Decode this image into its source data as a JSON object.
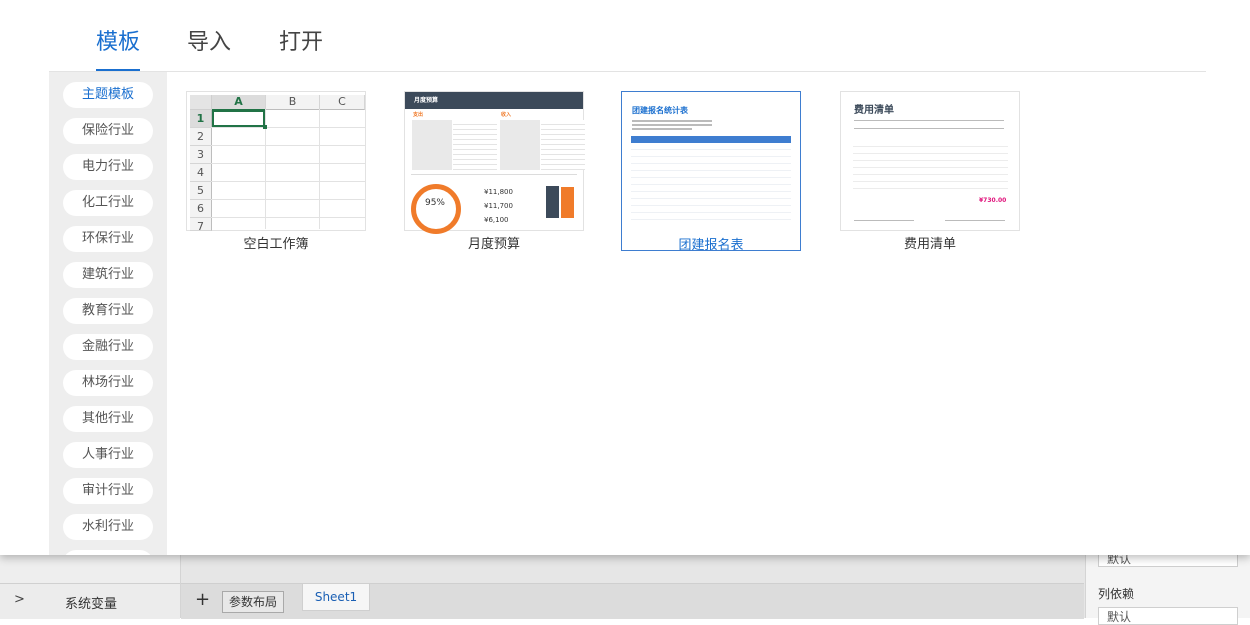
{
  "dialog": {
    "tabs": [
      {
        "label": "模板",
        "active": true
      },
      {
        "label": "导入",
        "active": false
      },
      {
        "label": "打开",
        "active": false
      }
    ],
    "categories": [
      "主题模板",
      "保险行业",
      "电力行业",
      "化工行业",
      "环保行业",
      "建筑行业",
      "教育行业",
      "金融行业",
      "林场行业",
      "其他行业",
      "人事行业",
      "审计行业",
      "水利行业"
    ],
    "active_category": "主题模板",
    "templates": [
      {
        "label": "空白工作簿",
        "selected": false
      },
      {
        "label": "月度预算",
        "selected": false
      },
      {
        "label": "团建报名表",
        "selected": true
      },
      {
        "label": "费用清单",
        "selected": false
      }
    ],
    "thumb_blank": {
      "columns": [
        "A",
        "B",
        "C"
      ],
      "rows": [
        "1",
        "2",
        "3",
        "4",
        "5",
        "6",
        "7"
      ]
    },
    "thumb_budget": {
      "title": "月度预算",
      "section_left": "支出",
      "section_right": "收入",
      "percent": "95%",
      "amount_1": "¥11,800",
      "amount_2": "¥11,700",
      "amount_3": "¥6,100"
    },
    "thumb_signup": {
      "title": "团建报名统计表"
    },
    "thumb_expense": {
      "title": "费用清单",
      "total": "¥730.00"
    }
  },
  "app": {
    "system_variables_label": "系统变量",
    "add_sheet_icon": "plus-icon",
    "sheet_tabs": [
      "参数布局",
      "Sheet1"
    ],
    "right_panel": {
      "select_1": "默认",
      "column_dependency_label": "列依赖",
      "select_2": "默认"
    }
  },
  "colors": {
    "accent": "#1a6fcf",
    "excel_green": "#217346",
    "budget_orange": "#f07b2a",
    "budget_dark": "#3c4a5a",
    "expense_total": "#e0117a"
  }
}
